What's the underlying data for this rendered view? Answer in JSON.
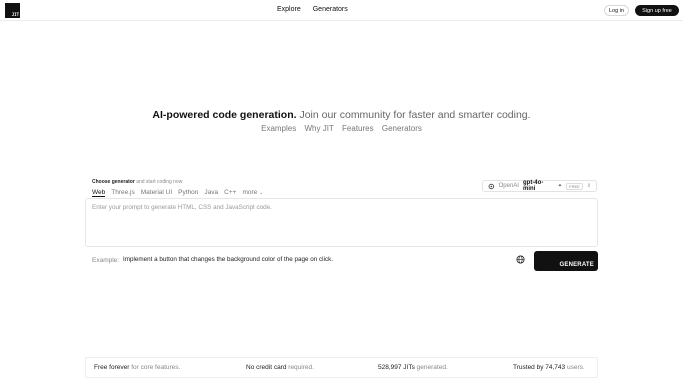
{
  "header": {
    "logo_text": "JIT",
    "nav": [
      "Explore",
      "Generators"
    ],
    "login_label": "Log in",
    "signup_label": "Sign up free"
  },
  "hero": {
    "headline_strong": "AI-powered code generation.",
    "headline_rest": "Join our community for faster and smarter coding.",
    "links": [
      "Examples",
      "Why JIT",
      "Features",
      "Generators"
    ]
  },
  "generator": {
    "choose_label_strong": "Choose generator",
    "choose_label_rest": "and start coding now",
    "tabs": [
      "Web",
      "Three.js",
      "Material UI",
      "Python",
      "Java",
      "C++",
      "more"
    ],
    "active_tab": "Web",
    "model": {
      "provider": "OpenAI",
      "name": "gpt-4o-mini",
      "badge": "FREE"
    },
    "prompt_placeholder": "Enter your prompt to generate HTML, CSS and JavaScript code.",
    "example_label": "Example:",
    "example_text": "Implement a button that changes the background color of the page on click.",
    "generate_label": "GENERATE"
  },
  "stats": [
    {
      "strong": "Free forever",
      "rest": "for core features."
    },
    {
      "strong": "No credit card",
      "rest": "required."
    },
    {
      "strong": "528,997 JITs",
      "rest": "generated."
    },
    {
      "strong": "Trusted by 74,743",
      "rest": "users."
    }
  ]
}
